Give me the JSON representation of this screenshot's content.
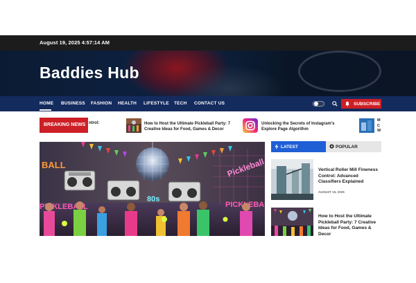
{
  "topbar": {
    "date": "August 19, 2025 4:57:14 AM"
  },
  "site": {
    "title": "Baddies Hub"
  },
  "nav": {
    "items": [
      "HOME",
      "BUSINESS",
      "FASHION",
      "HEALTH",
      "LIFESTYLE",
      "TECH",
      "CONTACT US"
    ],
    "subscribe": "SUBSCRIBE"
  },
  "breaking": {
    "label": "BREAKING NEWS",
    "items": [
      {
        "text": "ntrol:"
      },
      {
        "text": "How to Host the Ultimate Pickleball Party: 7 Creative Ideas for Food, Games & Decor"
      },
      {
        "text": "Unlocking the Secrets of Instagram's Explore Page Algorithm"
      },
      {
        "text": "M C W"
      }
    ]
  },
  "main_image": {
    "left_sign": "BALL",
    "left_sign_2": "PICKLEBALL",
    "right_sign": "Pickleball",
    "right_sign_2": "PICKLEBA",
    "center_text": "80s"
  },
  "sidebar": {
    "tabs": {
      "latest": "LATEST",
      "popular": "POPULAR"
    },
    "articles": [
      {
        "title": "Vertical Roller Mill Fineness Control: Advanced Classifiers Explained",
        "date": "AUGUST 15, 2025"
      },
      {
        "title": "How to Host the Ultimate Pickleball Party: 7 Creative Ideas for Food, Games & Decor"
      }
    ]
  },
  "colors": {
    "accent_red": "#cc1f26",
    "nav_blue": "#142b5e",
    "tab_blue": "#1f5fd6"
  }
}
